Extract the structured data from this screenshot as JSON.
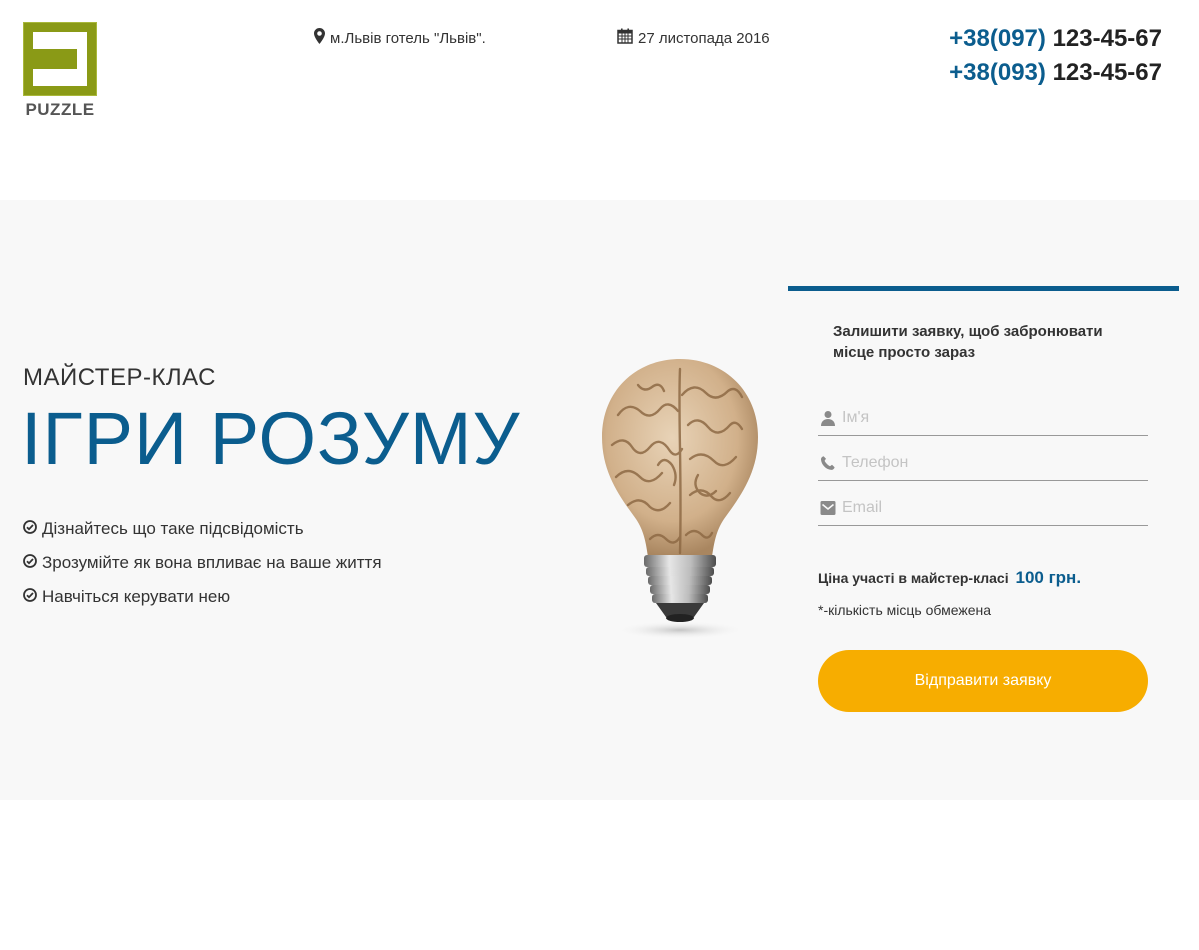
{
  "header": {
    "logo_text": "PUZZLE",
    "location": "м.Львів готель \"Львів\".",
    "date": "27 листопада 2016",
    "phones": [
      {
        "code": "+38(097)",
        "number": "123-45-67"
      },
      {
        "code": "+38(093)",
        "number": "123-45-67"
      }
    ]
  },
  "hero": {
    "subtitle": "МАЙСТЕР-КЛАС",
    "title": "ІГРИ РОЗУМУ",
    "features": [
      "Дізнайтесь що таке підсвідомість",
      "Зрозумійте як вона впливає на ваше життя",
      "Навчіться керувати нею"
    ]
  },
  "form": {
    "title": "Залишити заявку, щоб забронювати місце просто зараз",
    "name_placeholder": "Ім'я",
    "phone_placeholder": "Телефон",
    "email_placeholder": "Email",
    "price_label": "Ціна участі в майстер-класі",
    "price_value": "100 грн.",
    "note": "*-кількість місць обмежена",
    "submit_label": "Відправити заявку"
  },
  "icons": {
    "location": "map-marker-icon",
    "date": "calendar-icon",
    "feature": "check-circle-icon",
    "name": "user-icon",
    "phone": "phone-icon",
    "email": "envelope-icon"
  },
  "colors": {
    "accent_blue": "#0b5d8e",
    "button_yellow": "#f7ad00",
    "logo_green": "#8a9a16",
    "hero_bg": "#f8f8f8"
  }
}
